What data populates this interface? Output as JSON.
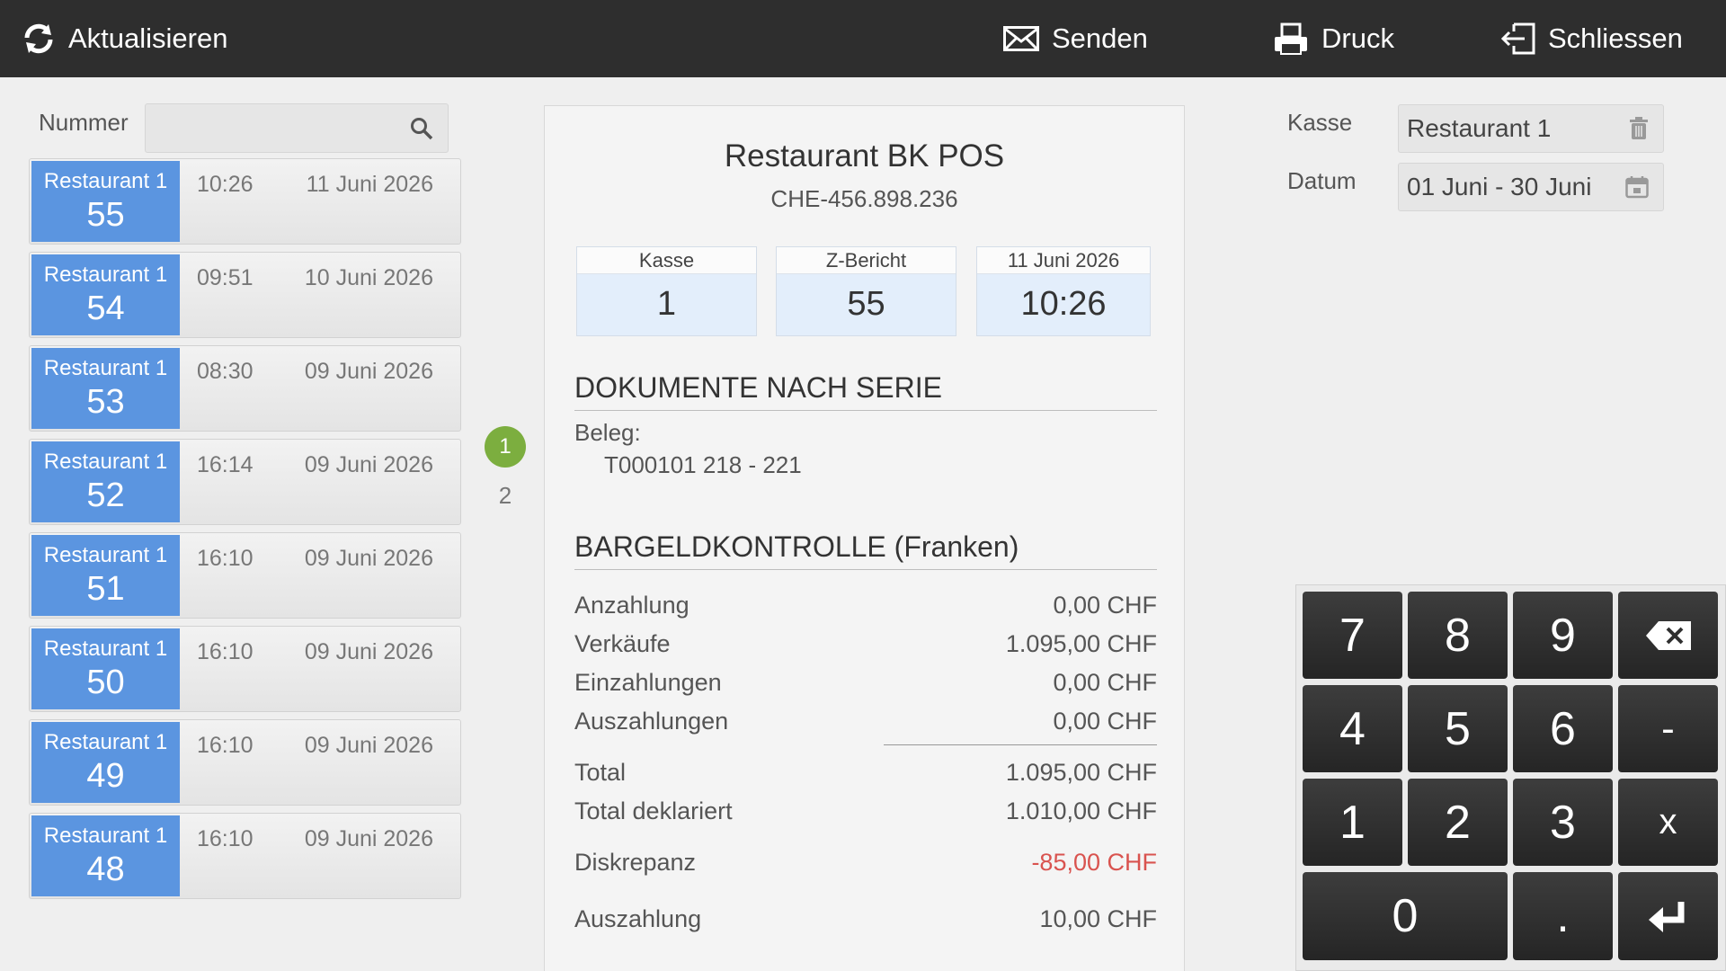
{
  "toolbar": {
    "refresh": "Aktualisieren",
    "send": "Senden",
    "print": "Druck",
    "close": "Schliessen"
  },
  "search": {
    "number_label": "Nummer",
    "number_value": ""
  },
  "reports": [
    {
      "name": "Restaurant 1",
      "number": "55",
      "time": "10:26",
      "date": "11 Juni 2026"
    },
    {
      "name": "Restaurant 1",
      "number": "54",
      "time": "09:51",
      "date": "10 Juni 2026"
    },
    {
      "name": "Restaurant 1",
      "number": "53",
      "time": "08:30",
      "date": "09 Juni 2026"
    },
    {
      "name": "Restaurant 1",
      "number": "52",
      "time": "16:14",
      "date": "09 Juni 2026"
    },
    {
      "name": "Restaurant 1",
      "number": "51",
      "time": "16:10",
      "date": "09 Juni 2026"
    },
    {
      "name": "Restaurant 1",
      "number": "50",
      "time": "16:10",
      "date": "09 Juni 2026"
    },
    {
      "name": "Restaurant 1",
      "number": "49",
      "time": "16:10",
      "date": "09 Juni 2026"
    },
    {
      "name": "Restaurant 1",
      "number": "48",
      "time": "16:10",
      "date": "09 Juni 2026"
    }
  ],
  "pagination": {
    "active": "1",
    "other": "2"
  },
  "report": {
    "title": "Restaurant BK POS",
    "vat": "CHE-456.898.236",
    "info": {
      "kasse_label": "Kasse",
      "kasse_value": "1",
      "z_label": "Z-Bericht",
      "z_value": "55",
      "date_label": "11 Juni 2026",
      "time_value": "10:26"
    },
    "docs_title": "DOKUMENTE NACH SERIE",
    "beleg_label": "Beleg:",
    "beleg_value": "T000101  218 - 221",
    "cash_title": "BARGELDKONTROLLE (Franken)",
    "rows": {
      "anzahlung": {
        "label": "Anzahlung",
        "value": "0,00 CHF"
      },
      "verkaeufe": {
        "label": "Verkäufe",
        "value": "1.095,00 CHF"
      },
      "einzahlungen": {
        "label": "Einzahlungen",
        "value": "0,00 CHF"
      },
      "auszahlungen": {
        "label": "Auszahlungen",
        "value": "0,00 CHF"
      },
      "total": {
        "label": "Total",
        "value": "1.095,00 CHF"
      },
      "total_deklariert": {
        "label": "Total deklariert",
        "value": "1.010,00 CHF"
      },
      "diskrepanz": {
        "label": "Diskrepanz",
        "value": "-85,00 CHF"
      },
      "auszahlung": {
        "label": "Auszahlung",
        "value": "10,00 CHF"
      }
    }
  },
  "filters": {
    "kasse_label": "Kasse",
    "kasse_value": "Restaurant 1",
    "datum_label": "Datum",
    "datum_value": "01 Juni - 30 Juni"
  },
  "keypad": {
    "k7": "7",
    "k8": "8",
    "k9": "9",
    "k4": "4",
    "k5": "5",
    "k6": "6",
    "minus": "-",
    "k1": "1",
    "k2": "2",
    "k3": "3",
    "times": "x",
    "k0": "0",
    "dot": "."
  },
  "colors": {
    "topbar": "#2e2e2e",
    "badge_blue": "#5b95e0",
    "page_active": "#7cae3f",
    "negative": "#d9534f",
    "key_dark": "#2f2f2f"
  }
}
